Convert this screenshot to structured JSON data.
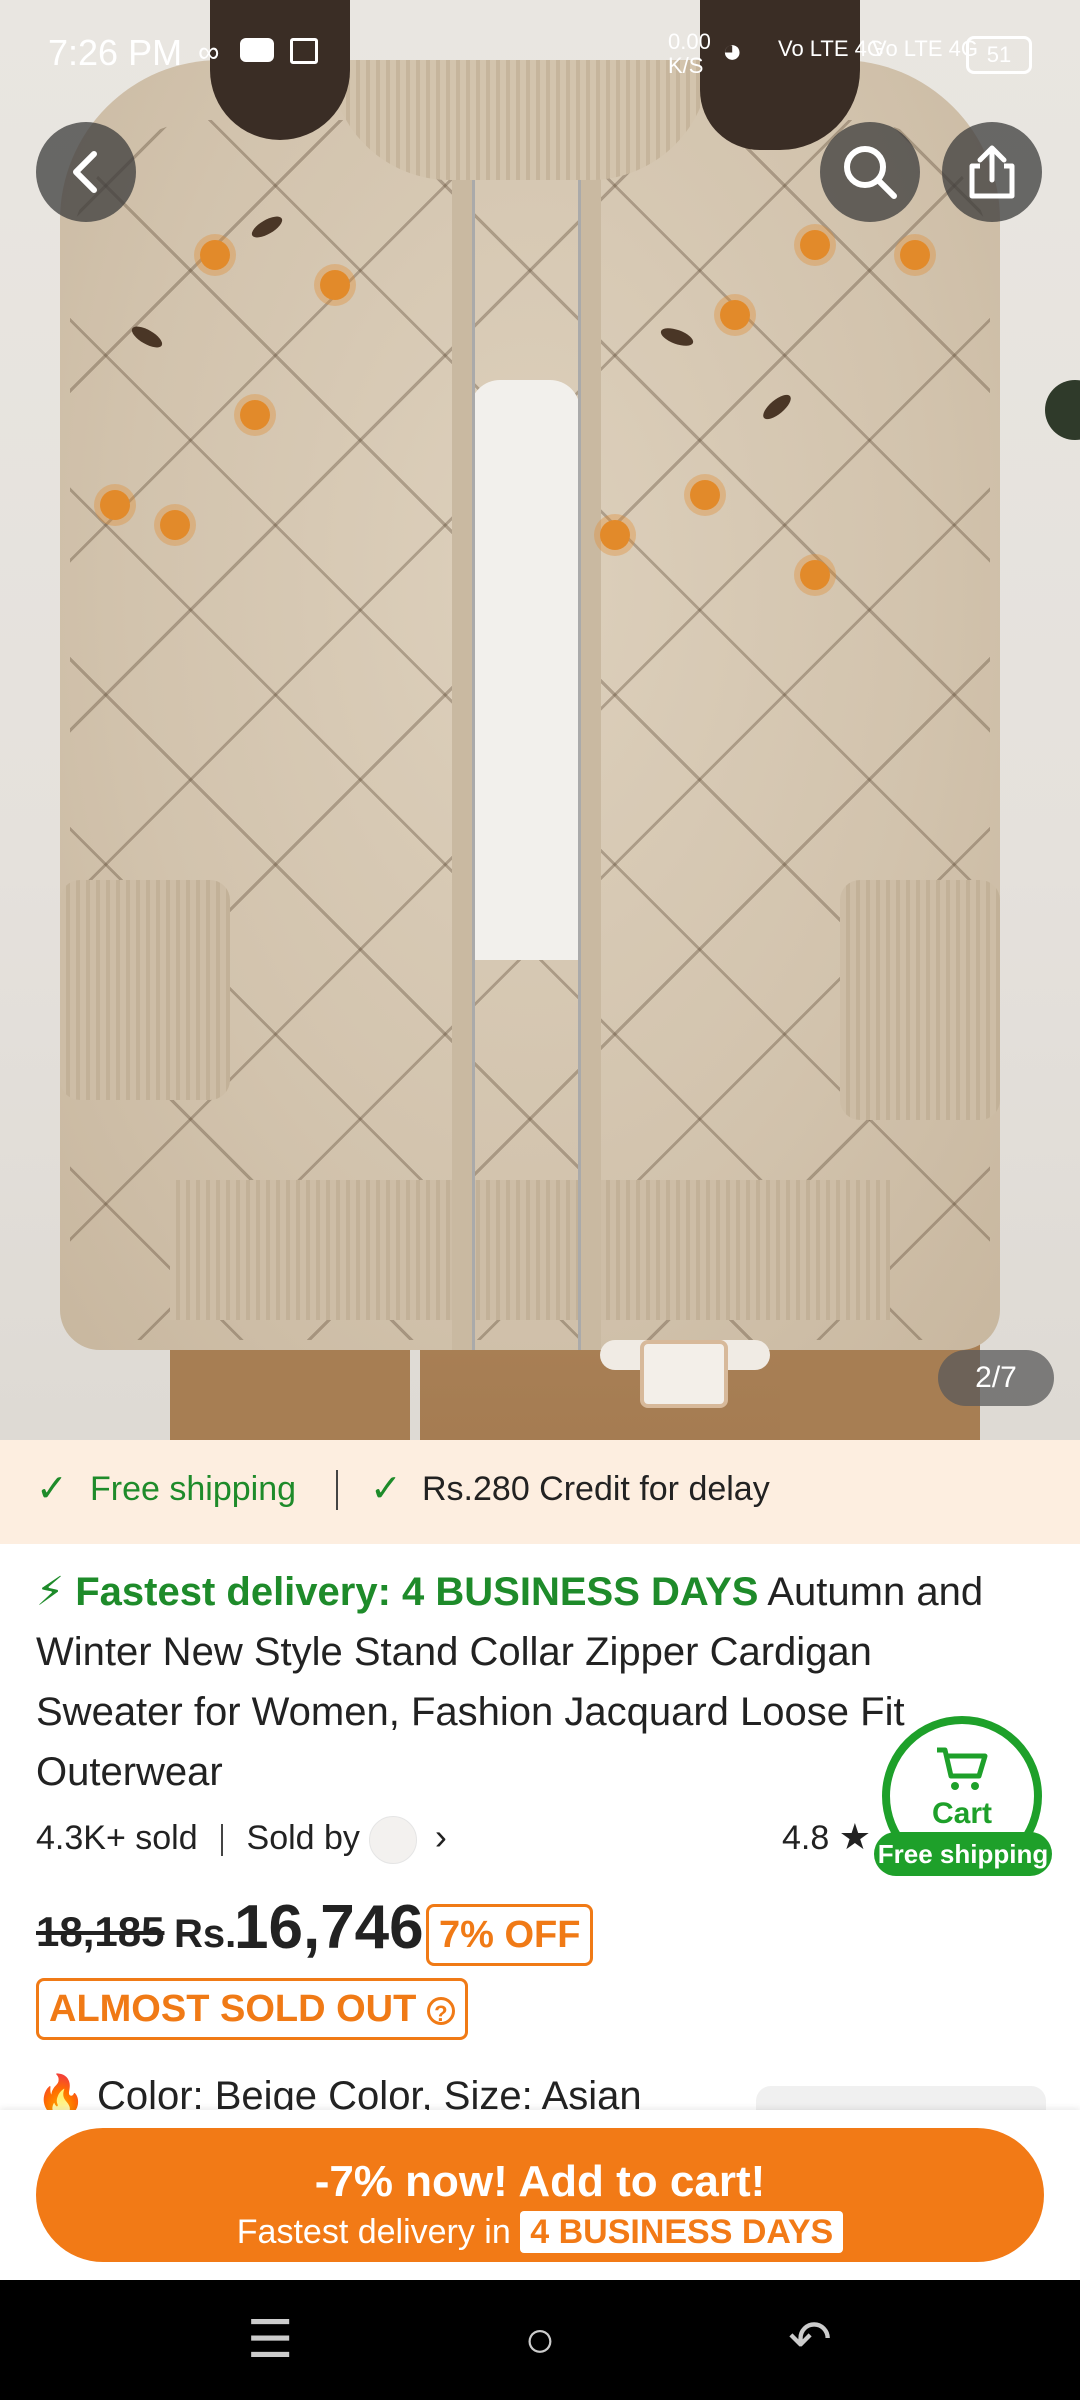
{
  "status_bar": {
    "time": "7:26 PM",
    "net_speed_value": "0.00",
    "net_speed_unit": "K/S",
    "sim1": "Vo LTE 4G",
    "sim2": "Vo LTE 4G",
    "battery": "51"
  },
  "gallery": {
    "counter": "2/7",
    "image_alt": "Beige floral jacquard zip cardigan"
  },
  "shipping_strip": {
    "free_shipping": "Free shipping",
    "credit": "Rs.280 Credit for delay"
  },
  "product": {
    "fast_delivery": "Fastest delivery: 4 BUSINESS DAYS",
    "title": "Autumn and Winter New Style Stand Collar Zipper Cardigan Sweater for Women, Fashion Jacquard Loose Fit Outerwear",
    "sold": "4.3K+ sold",
    "sold_by": "Sold by",
    "rating": "4.8",
    "old_price": "18,185",
    "currency": "Rs.",
    "price": "16,746",
    "discount": "7% OFF",
    "stock_status": "ALMOST SOLD OUT",
    "variant_line": "Color: Beige Color, Size: Asian"
  },
  "cart_float": {
    "label": "Cart",
    "badge": "Free shipping"
  },
  "cta": {
    "main": "-7% now! Add to cart!",
    "sub_prefix": "Fastest delivery in",
    "sub_badge": "4 BUSINESS DAYS"
  },
  "colors": {
    "accent_orange": "#f27a16",
    "green": "#1e8b2a",
    "strip_bg": "#fdeee0"
  }
}
